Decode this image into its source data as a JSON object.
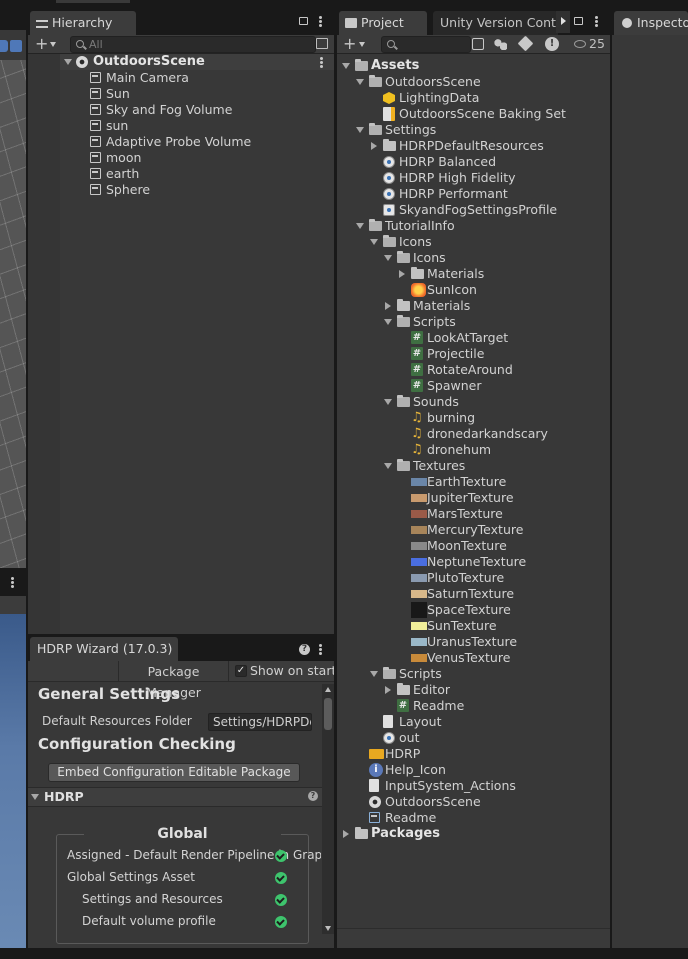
{
  "hierarchy": {
    "tab_label": "Hierarchy",
    "search_placeholder": "All",
    "scene_name": "OutdoorsScene",
    "items": [
      "Main Camera",
      "Sun",
      "Sky and Fog Volume",
      "sun",
      "Adaptive Probe Volume",
      "moon",
      "earth",
      "Sphere"
    ]
  },
  "project": {
    "tab_label": "Project",
    "tab2_label": "Unity Version Contro",
    "inspector_label": "Inspector",
    "hidden_count": "25",
    "tree": [
      {
        "label": "Assets",
        "icon": "folder-icon",
        "bold": true
      },
      {
        "label": "OutdoorsScene",
        "icon": "folder-icon"
      },
      {
        "label": "LightingData",
        "icon": "lighting-data-icon"
      },
      {
        "label": "OutdoorsScene Baking Set",
        "icon": "baking-set-icon"
      },
      {
        "label": "Settings",
        "icon": "folder-icon"
      },
      {
        "label": "HDRPDefaultResources",
        "icon": "folder-icon"
      },
      {
        "label": "HDRP Balanced",
        "icon": "render-pipeline-asset-icon"
      },
      {
        "label": "HDRP High Fidelity",
        "icon": "render-pipeline-asset-icon"
      },
      {
        "label": "HDRP Performant",
        "icon": "render-pipeline-asset-icon"
      },
      {
        "label": "SkyandFogSettingsProfile",
        "icon": "volume-profile-icon"
      },
      {
        "label": "TutorialInfo",
        "icon": "folder-icon"
      },
      {
        "label": "Icons",
        "icon": "folder-icon"
      },
      {
        "label": "Icons",
        "icon": "folder-icon"
      },
      {
        "label": "Materials",
        "icon": "folder-icon"
      },
      {
        "label": "SunIcon",
        "icon": "sun-texture-icon"
      },
      {
        "label": "Materials",
        "icon": "folder-icon"
      },
      {
        "label": "Scripts",
        "icon": "folder-icon"
      },
      {
        "label": "LookAtTarget",
        "icon": "script-icon"
      },
      {
        "label": "Projectile",
        "icon": "script-icon"
      },
      {
        "label": "RotateAround",
        "icon": "script-icon"
      },
      {
        "label": "Spawner",
        "icon": "script-icon"
      },
      {
        "label": "Sounds",
        "icon": "folder-icon"
      },
      {
        "label": "burning",
        "icon": "audio-icon"
      },
      {
        "label": "dronedarkandscary",
        "icon": "audio-icon"
      },
      {
        "label": "dronehum",
        "icon": "audio-icon"
      },
      {
        "label": "Textures",
        "icon": "folder-icon"
      },
      {
        "label": "EarthTexture",
        "icon": "texture-icon",
        "color": "#6a86a8"
      },
      {
        "label": "JupiterTexture",
        "icon": "texture-icon",
        "color": "#c89a6e"
      },
      {
        "label": "MarsTexture",
        "icon": "texture-icon",
        "color": "#9a5a48"
      },
      {
        "label": "MercuryTexture",
        "icon": "texture-icon",
        "color": "#a8855a"
      },
      {
        "label": "MoonTexture",
        "icon": "texture-icon",
        "color": "#8a8a8a"
      },
      {
        "label": "NeptuneTexture",
        "icon": "texture-icon",
        "color": "#4a6ee0"
      },
      {
        "label": "PlutoTexture",
        "icon": "texture-icon",
        "color": "#8a9ab0"
      },
      {
        "label": "SaturnTexture",
        "icon": "texture-icon",
        "color": "#d8b88a"
      },
      {
        "label": "SpaceTexture",
        "icon": "texture-icon",
        "color": "#181818"
      },
      {
        "label": "SunTexture",
        "icon": "texture-icon",
        "color": "#f2f09a"
      },
      {
        "label": "UranusTexture",
        "icon": "texture-icon",
        "color": "#9ab8c8"
      },
      {
        "label": "VenusTexture",
        "icon": "texture-icon",
        "color": "#c88a3a"
      },
      {
        "label": "Scripts",
        "icon": "folder-icon"
      },
      {
        "label": "Editor",
        "icon": "folder-icon"
      },
      {
        "label": "Readme",
        "icon": "script-icon"
      },
      {
        "label": "Layout",
        "icon": "file-icon"
      },
      {
        "label": "out",
        "icon": "round-asset-icon"
      },
      {
        "label": "HDRP",
        "icon": "hdrp-asset-icon"
      },
      {
        "label": "Help_Icon",
        "icon": "help-icon"
      },
      {
        "label": "InputSystem_Actions",
        "icon": "file-icon"
      },
      {
        "label": "OutdoorsScene",
        "icon": "scene-icon"
      },
      {
        "label": "Readme",
        "icon": "readme-asset-icon"
      },
      {
        "label": "Packages",
        "icon": "folder-icon",
        "bold": true
      }
    ]
  },
  "wizard": {
    "tab_label": "HDRP Wizard (17.0.3)",
    "package_manager": "Package Manager",
    "show_on_start": "Show on start",
    "general_settings": "General Settings",
    "default_resources_label": "Default Resources Folder",
    "default_resources_value": "Settings/HDRPDe",
    "config_checking": "Configuration Checking",
    "embed_button": "Embed Configuration Editable Package",
    "hdrp_section": "HDRP",
    "global_header": "Global",
    "checks": [
      "Assigned - Default Render Pipeline in Graphic",
      "Global Settings Asset",
      "Settings and Resources",
      "Default volume profile"
    ]
  },
  "colors": {
    "panel": "#383838",
    "tab_active": "#3c3c3c",
    "check_ok": "#3ec46d",
    "audio": "#e8b53a",
    "script": "#3f6f42"
  }
}
